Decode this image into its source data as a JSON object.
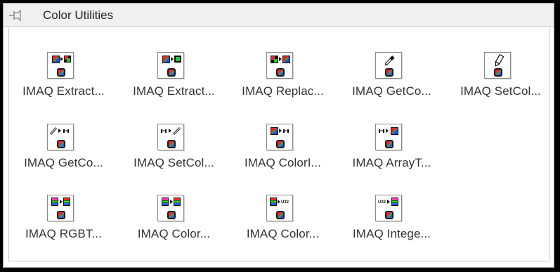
{
  "window": {
    "title": "Color Utilities"
  },
  "rows": [
    [
      {
        "label": "IMAQ Extract...",
        "icon": "extract-color-plane-icon"
      },
      {
        "label": "IMAQ Extract...",
        "icon": "extract-single-plane-icon"
      },
      {
        "label": "IMAQ Replac...",
        "icon": "replace-color-plane-icon"
      },
      {
        "label": "IMAQ GetCo...",
        "icon": "eyedropper-get-color-icon"
      },
      {
        "label": "IMAQ SetCol...",
        "icon": "pencil-set-color-icon"
      }
    ],
    [
      {
        "label": "IMAQ GetCo...",
        "icon": "get-color-line-icon"
      },
      {
        "label": "IMAQ SetCol...",
        "icon": "set-color-line-icon"
      },
      {
        "label": "IMAQ ColorI...",
        "icon": "color-image-to-array-icon"
      },
      {
        "label": "IMAQ ArrayT...",
        "icon": "array-to-color-image-icon"
      }
    ],
    [
      {
        "label": "IMAQ RGBT...",
        "icon": "rgb-to-color-icon"
      },
      {
        "label": "IMAQ Color...",
        "icon": "color-value-conversion-icon"
      },
      {
        "label": "IMAQ Color...",
        "icon": "color-to-u32-icon"
      },
      {
        "label": "IMAQ Intege...",
        "icon": "u32-to-color-icon"
      }
    ]
  ]
}
